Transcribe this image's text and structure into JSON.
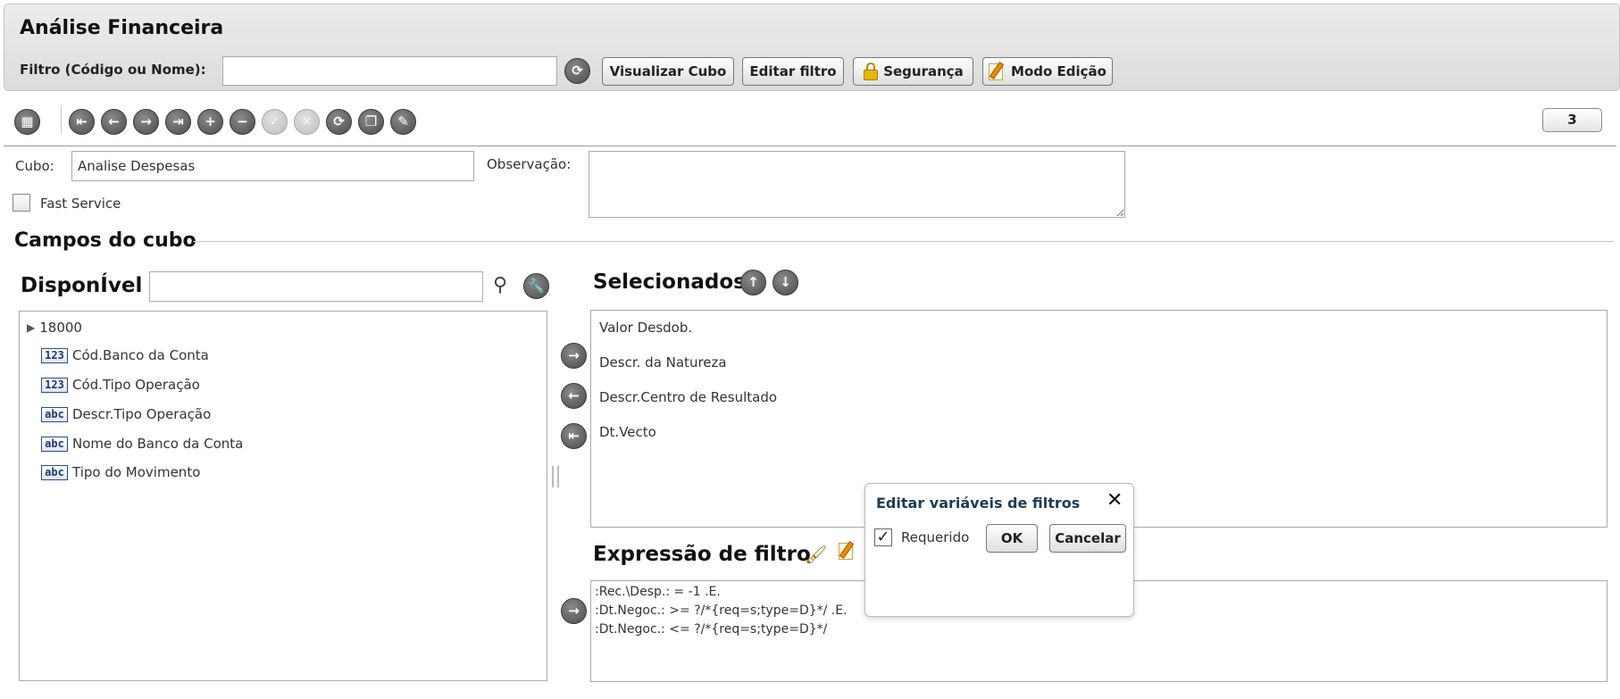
{
  "header": {
    "title": "Análise Financeira",
    "filter_label": "Filtro (Código ou Nome):",
    "filter_value": "",
    "buttons": {
      "view_cube": "Visualizar Cubo",
      "edit_filter": "Editar filtro",
      "security": "Segurança",
      "edit_mode": "Modo Edição"
    }
  },
  "toolbar": {
    "page_number": "3",
    "icons": [
      "grid-icon",
      "first-icon",
      "previous-icon",
      "next-icon",
      "last-icon",
      "add-icon",
      "remove-icon",
      "confirm-icon",
      "cancel-icon",
      "refresh-icon",
      "copy-icon",
      "edit-icon"
    ]
  },
  "form": {
    "cubo_label": "Cubo:",
    "cubo_value": "Analise Despesas",
    "observacao_label": "Observação:",
    "observacao_value": "",
    "fast_service_label": "Fast Service",
    "fast_service_checked": false
  },
  "section": {
    "title": "Campos do cubo"
  },
  "available": {
    "heading": "DisponÍvel",
    "search_value": "",
    "tree_root": "18000",
    "items": [
      {
        "type": "123",
        "label": "Cód.Banco da Conta"
      },
      {
        "type": "123",
        "label": "Cód.Tipo Operação"
      },
      {
        "type": "abc",
        "label": "Descr.Tipo Operação"
      },
      {
        "type": "abc",
        "label": "Nome do Banco da Conta"
      },
      {
        "type": "abc",
        "label": "Tipo do Movimento"
      }
    ]
  },
  "selected": {
    "heading": "Selecionados",
    "items": [
      "Valor Desdob.",
      "Descr. da Natureza",
      "Descr.Centro de Resultado",
      "Dt.Vecto"
    ]
  },
  "filter_expression": {
    "heading": "Expressão de filtro",
    "lines": [
      ":Rec.\\Desp.: = -1 .E.",
      ":Dt.Negoc.: >= ?/*{req=s;type=D}*/ .E.",
      ":Dt.Negoc.: <= ?/*{req=s;type=D}*/"
    ]
  },
  "dialog": {
    "title": "Editar variáveis de filtros",
    "required_label": "Requerido",
    "required_checked": true,
    "ok_label": "OK",
    "cancel_label": "Cancelar"
  }
}
